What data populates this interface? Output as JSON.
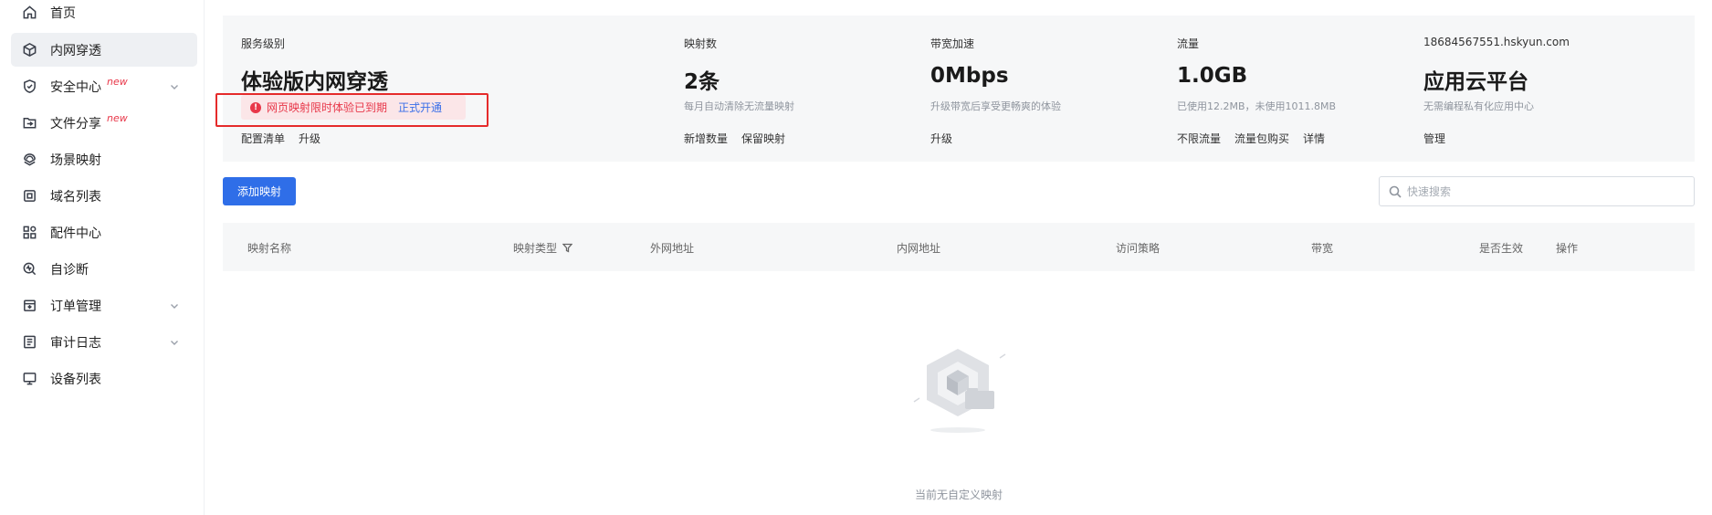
{
  "sidebar": {
    "items": [
      {
        "label": "首页",
        "icon": "home-icon",
        "new": "",
        "chevron": false
      },
      {
        "label": "内网穿透",
        "icon": "cube-icon",
        "new": "",
        "chevron": false
      },
      {
        "label": "安全中心",
        "icon": "shield-icon",
        "new": "new",
        "chevron": true
      },
      {
        "label": "文件分享",
        "icon": "file-share-icon",
        "new": "new",
        "chevron": false
      },
      {
        "label": "场景映射",
        "icon": "scene-icon",
        "new": "",
        "chevron": false
      },
      {
        "label": "域名列表",
        "icon": "domain-icon",
        "new": "",
        "chevron": false
      },
      {
        "label": "配件中心",
        "icon": "grid-icon",
        "new": "",
        "chevron": false
      },
      {
        "label": "自诊断",
        "icon": "diagnose-icon",
        "new": "",
        "chevron": false
      },
      {
        "label": "订单管理",
        "icon": "order-icon",
        "new": "",
        "chevron": true
      },
      {
        "label": "审计日志",
        "icon": "log-icon",
        "new": "",
        "chevron": true
      },
      {
        "label": "设备列表",
        "icon": "monitor-icon",
        "new": "",
        "chevron": false
      }
    ],
    "active_index": 1
  },
  "info": {
    "service": {
      "label": "服务级别",
      "value": "体验版内网穿透",
      "alert_text": "网页映射限时体验已到期",
      "alert_link": "正式开通",
      "actions": [
        "配置清单",
        "升级"
      ]
    },
    "mappings": {
      "label": "映射数",
      "value": "2条",
      "desc": "每月自动清除无流量映射",
      "actions": [
        "新增数量",
        "保留映射"
      ]
    },
    "bandwidth": {
      "label": "带宽加速",
      "value": "0Mbps",
      "desc": "升级带宽后享受更畅爽的体验",
      "actions": [
        "升级"
      ]
    },
    "traffic": {
      "label": "流量",
      "value": "1.0GB",
      "desc": "已使用12.2MB，未使用1011.8MB",
      "actions": [
        "不限流量",
        "流量包购买",
        "详情"
      ]
    },
    "account": {
      "label": "18684567551.hskyun.com",
      "value": "应用云平台",
      "desc": "无需编程私有化应用中心",
      "actions": [
        "管理"
      ]
    }
  },
  "toolbar": {
    "add_label": "添加映射",
    "search_placeholder": "快速搜索"
  },
  "table": {
    "columns": [
      "映射名称",
      "映射类型",
      "外网地址",
      "内网地址",
      "访问策略",
      "带宽",
      "是否生效",
      "操作"
    ]
  },
  "empty": {
    "text": "当前无自定义映射"
  },
  "colors": {
    "primary": "#2f6ee8",
    "danger": "#e8384a",
    "panel_bg": "#f6f7f8"
  }
}
